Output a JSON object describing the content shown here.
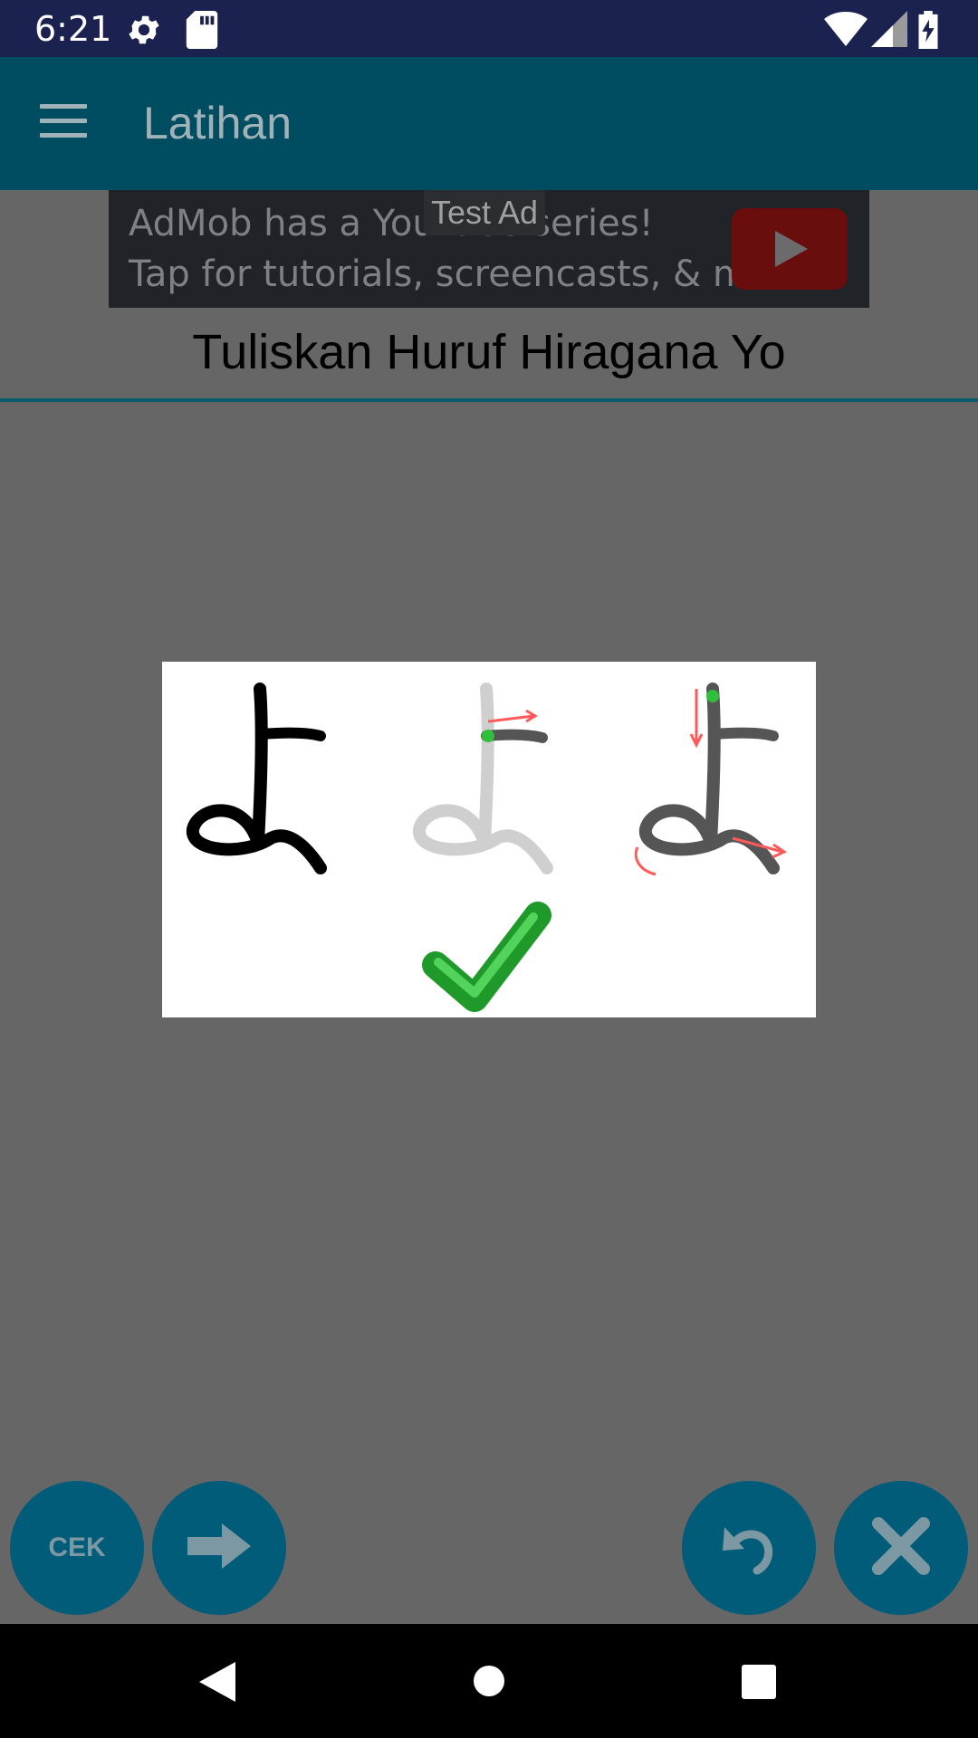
{
  "status_bar": {
    "time": "6:21"
  },
  "app_bar": {
    "title": "Latihan"
  },
  "ad": {
    "badge": "Test Ad",
    "line1": "AdMob has a YouTube series!",
    "line2": "Tap for tutorials, screencasts, & more."
  },
  "question": {
    "text": "Tuliskan Huruf Hiragana Yo"
  },
  "buttons": {
    "check_label": "CEK"
  },
  "icons": {
    "menu": "hamburger-menu-icon",
    "settings": "gear-icon",
    "sd_card": "sd-card-icon",
    "wifi": "wifi-icon",
    "signal": "signal-icon",
    "battery": "battery-charging-icon",
    "next": "arrow-right-icon",
    "undo": "undo-icon",
    "close": "close-icon",
    "back": "nav-back-icon",
    "home": "nav-home-icon",
    "recents": "nav-recents-icon",
    "check": "checkmark-icon"
  },
  "colors": {
    "status_bar": "#1b2250",
    "app_bar": "#004d62",
    "accent": "#005c78",
    "scrim": "#666666"
  }
}
